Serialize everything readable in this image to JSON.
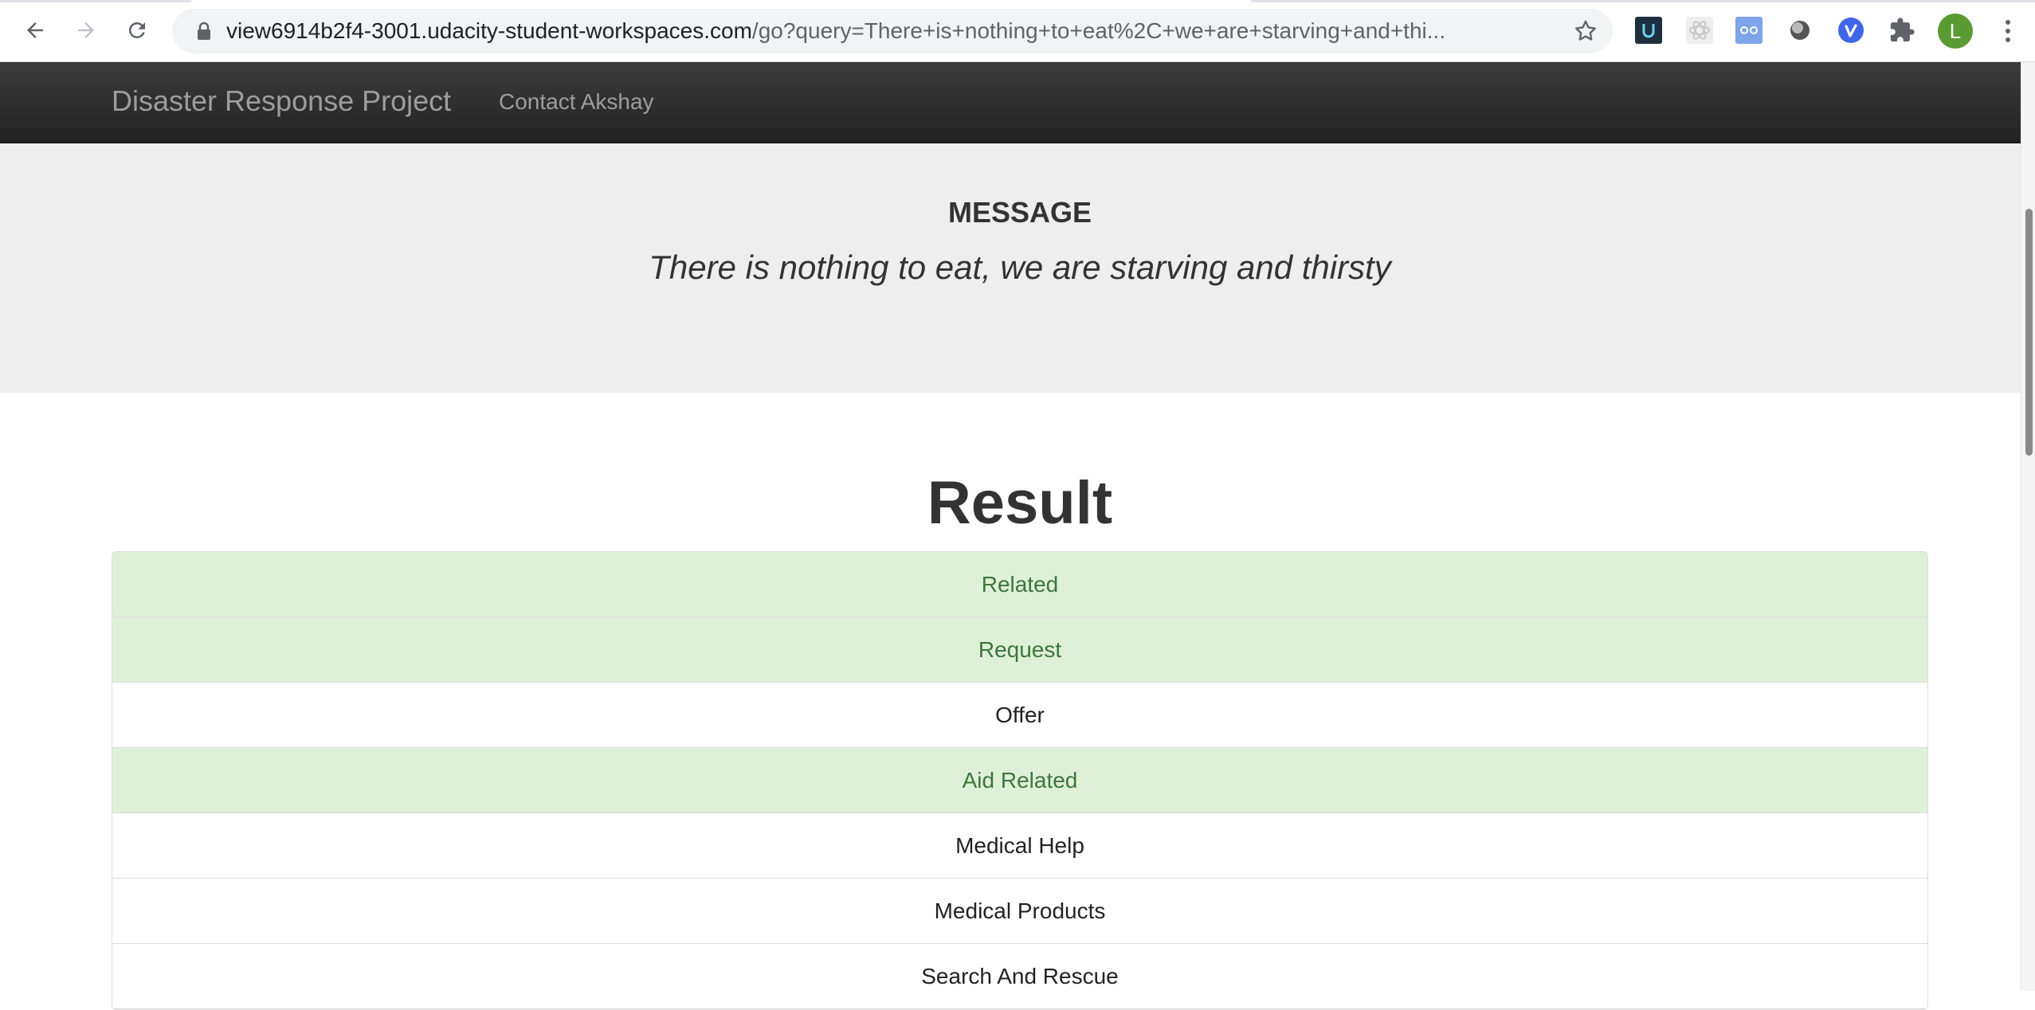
{
  "browser": {
    "url_host": "view6914b2f4-3001.udacity-student-workspaces.com",
    "url_path": "/go?query=There+is+nothing+to+eat%2C+we+are+starving+and+thi...",
    "profile_initial": "L"
  },
  "navbar": {
    "brand": "Disaster Response Project",
    "link": "Contact Akshay",
    "background": "#222222"
  },
  "message": {
    "heading": "MESSAGE",
    "text": "There is nothing to eat, we are starving and thirsty"
  },
  "result": {
    "title": "Result",
    "categories": [
      {
        "label": "Related",
        "positive": true
      },
      {
        "label": "Request",
        "positive": true
      },
      {
        "label": "Offer",
        "positive": false
      },
      {
        "label": "Aid Related",
        "positive": true
      },
      {
        "label": "Medical Help",
        "positive": false
      },
      {
        "label": "Medical Products",
        "positive": false
      },
      {
        "label": "Search And Rescue",
        "positive": false
      }
    ]
  },
  "colors": {
    "positive_bg": "#dff0d8",
    "positive_text": "#3c763d",
    "jumbotron_bg": "#eeeeee"
  }
}
